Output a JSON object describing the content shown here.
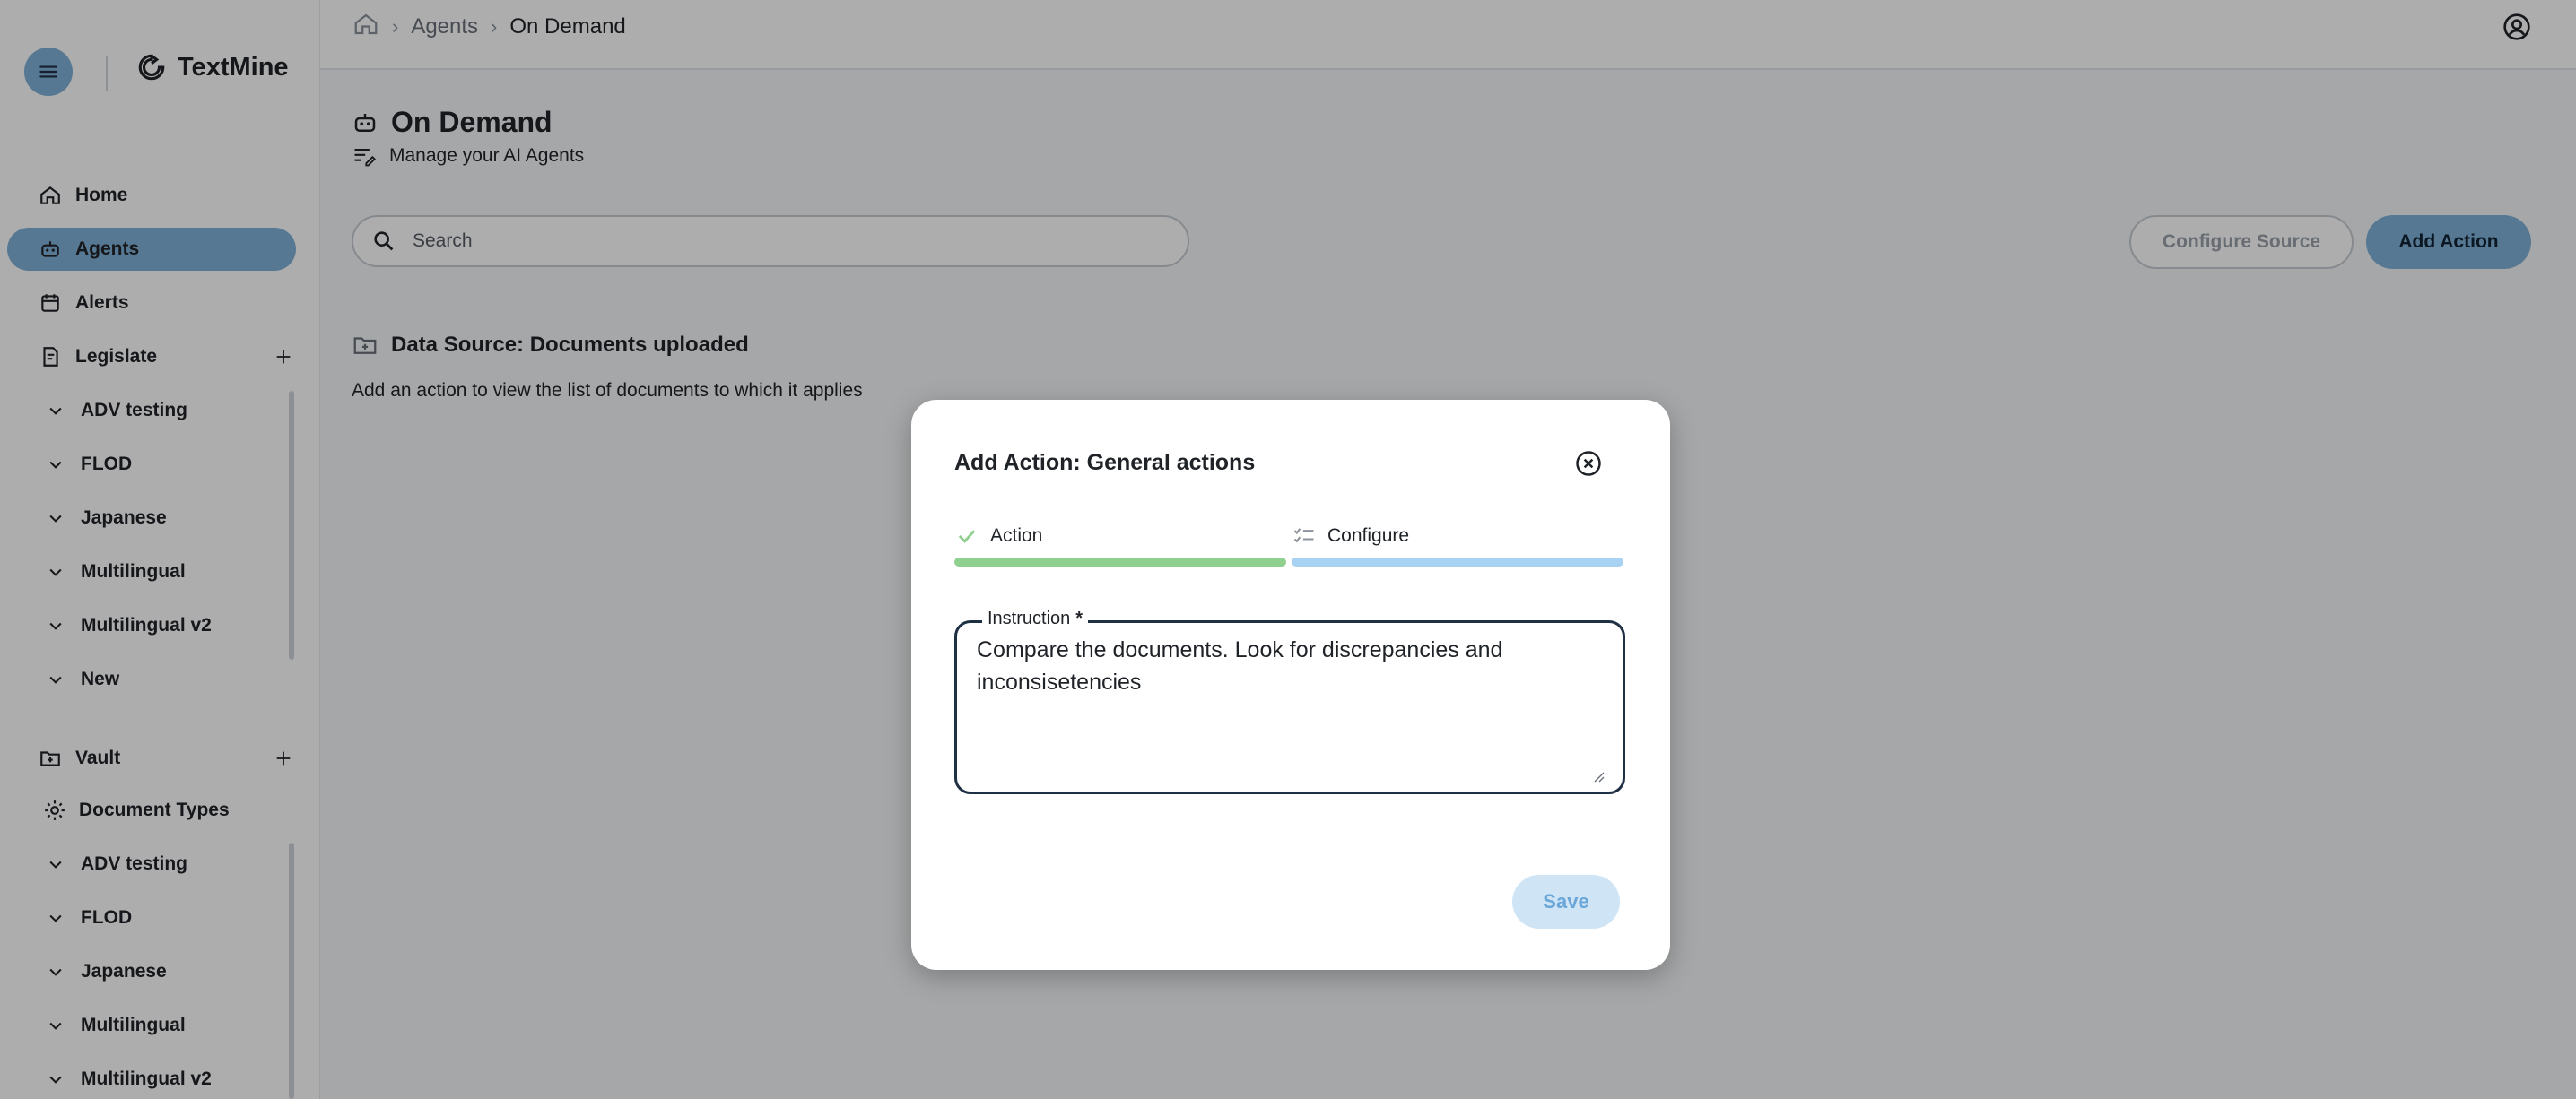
{
  "brand": {
    "name": "TextMine"
  },
  "sidebar": {
    "primary": [
      {
        "label": "Home"
      },
      {
        "label": "Agents"
      },
      {
        "label": "Alerts"
      },
      {
        "label": "Legislate"
      }
    ],
    "legislate_items": [
      "ADV testing",
      "FLOD",
      "Japanese",
      "Multilingual",
      "Multilingual v2",
      "New"
    ],
    "vault": {
      "label": "Vault"
    },
    "doc_types": {
      "label": "Document Types"
    },
    "vault_items": [
      "ADV testing",
      "FLOD",
      "Japanese",
      "Multilingual",
      "Multilingual v2"
    ]
  },
  "breadcrumb": {
    "parent": "Agents",
    "current": "On Demand"
  },
  "page": {
    "title": "On Demand",
    "subtitle": "Manage your AI Agents",
    "search_placeholder": "Search",
    "configure_source": "Configure Source",
    "add_action": "Add Action",
    "data_source_title": "Data Source: Documents uploaded",
    "data_source_desc": "Add an action to view the list of documents to which it applies"
  },
  "modal": {
    "title": "Add Action: General actions",
    "steps": [
      {
        "label": "Action",
        "status": "done"
      },
      {
        "label": "Configure",
        "status": "current"
      }
    ],
    "field_label": "Instruction",
    "required_mark": "*",
    "instruction_value": "Compare the documents. Look for discrepancies and inconsisetencies",
    "save_label": "Save"
  },
  "colors": {
    "accent": "#7fb1d8",
    "progress_done": "#8fd08e",
    "progress_todo": "#a8d2f2",
    "overlay": "rgba(0,0,0,0.32)"
  }
}
